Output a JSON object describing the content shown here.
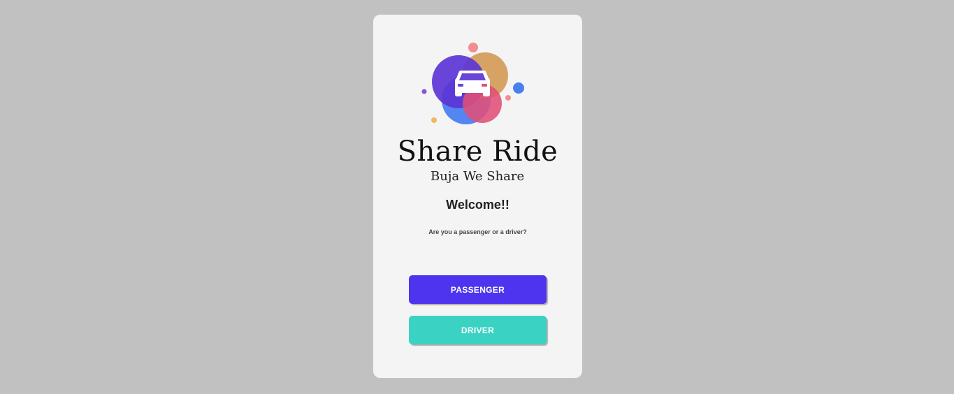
{
  "brand": {
    "title": "Share Ride",
    "tagline": "Buja We Share"
  },
  "welcome": {
    "heading": "Welcome!!",
    "question": "Are you a passenger or a driver?"
  },
  "buttons": {
    "passenger_label": "PASSENGER",
    "driver_label": "DRIVER"
  },
  "colors": {
    "background": "#c1c1c1",
    "card": "#f4f4f5",
    "passenger_button": "#4e34ee",
    "driver_button": "#3ad3c3",
    "logo_purple": "#5b35d5",
    "logo_blue": "#4a7ff0",
    "logo_orange": "#d49a55",
    "logo_pink": "#e05077"
  },
  "icons": {
    "logo": "car-icon"
  }
}
